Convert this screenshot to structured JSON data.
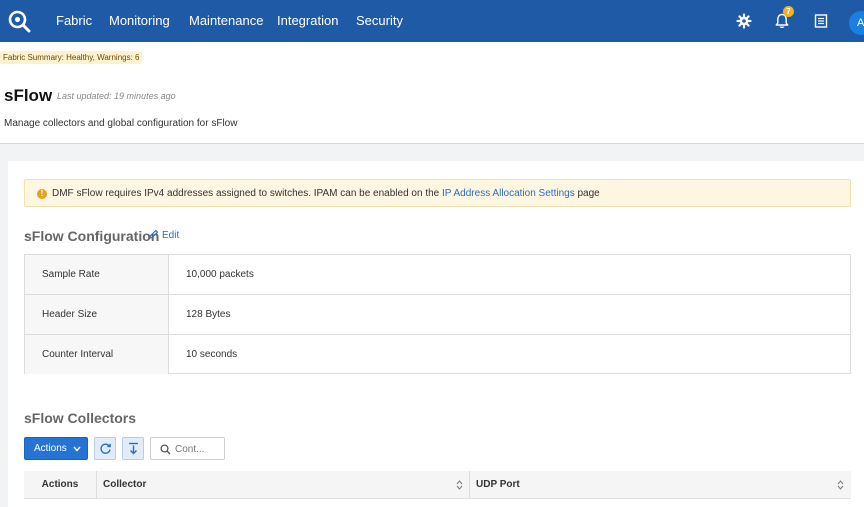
{
  "nav": {
    "items": [
      "Fabric",
      "Monitoring",
      "Maintenance",
      "Integration",
      "Security"
    ],
    "notification_count": "7",
    "avatar_initial": "A"
  },
  "fabric_summary": "Fabric Summary: Healthy, Warnings: 6",
  "page": {
    "title": "sFlow",
    "last_updated": "Last updated: 19 minutes ago",
    "description": "Manage collectors and global configuration for sFlow"
  },
  "alert": {
    "text_before": "DMF sFlow requires IPv4 addresses assigned to switches. IPAM can be enabled on the ",
    "link": "IP Address Allocation Settings",
    "text_after": " page"
  },
  "config": {
    "title": "sFlow Configuration",
    "edit_label": "Edit",
    "rows": [
      {
        "key": "Sample Rate",
        "value": "10,000 packets"
      },
      {
        "key": "Header Size",
        "value": "128 Bytes"
      },
      {
        "key": "Counter Interval",
        "value": "10 seconds"
      }
    ]
  },
  "collectors": {
    "title": "sFlow Collectors",
    "actions_label": "Actions",
    "search_placeholder": "Cont...",
    "columns": [
      "Actions",
      "Collector",
      "UDP Port"
    ]
  },
  "colors": {
    "navbar": "#1f5aa6",
    "primary_button": "#2574d4",
    "warning": "#e4a11b",
    "link": "#2b6cc4"
  }
}
